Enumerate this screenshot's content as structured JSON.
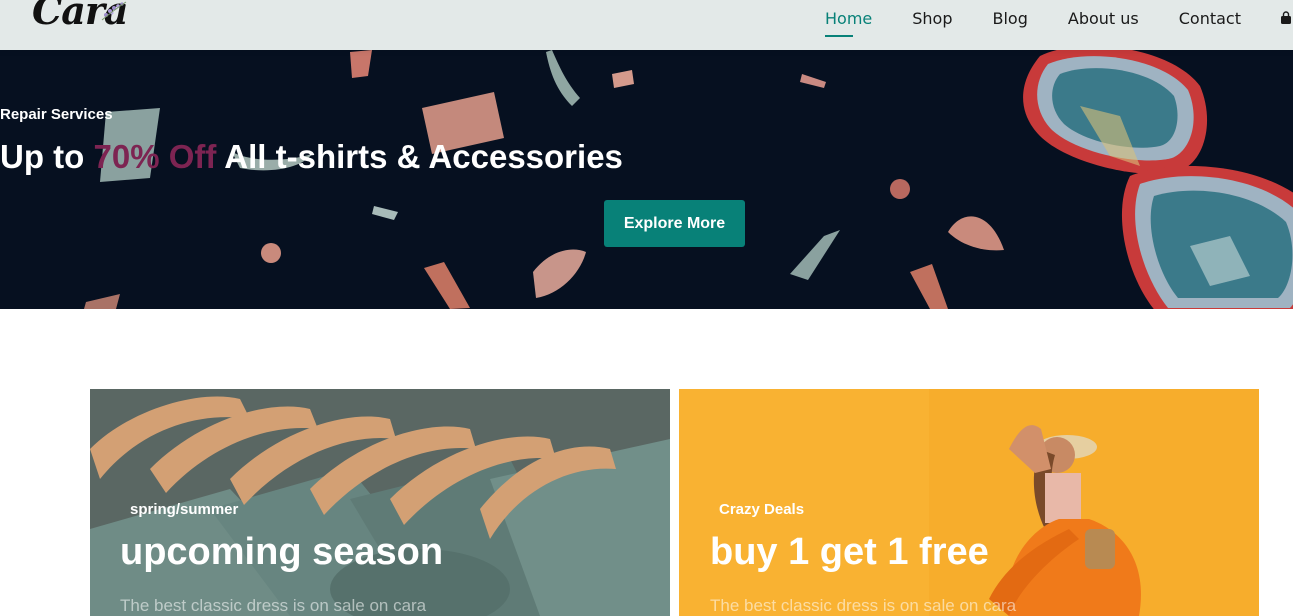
{
  "header": {
    "logo_text": "Cara",
    "nav": [
      {
        "label": "Home",
        "active": true
      },
      {
        "label": "Shop",
        "active": false
      },
      {
        "label": "Blog",
        "active": false
      },
      {
        "label": "About us",
        "active": false
      },
      {
        "label": "Contact",
        "active": false
      }
    ],
    "cart_icon": "shopping-bag-icon"
  },
  "hero": {
    "kicker": "Repair Services",
    "title_prefix": "Up to ",
    "title_accent": "70% Off",
    "title_suffix": " All t-shirts & Accessories",
    "cta_label": "Explore More",
    "accent_color": "#7d2452",
    "cta_color": "#088178"
  },
  "banners": [
    {
      "kicker": "spring/summer",
      "title": "upcoming season",
      "text": "The best classic dress is on sale on cara"
    },
    {
      "kicker": "Crazy Deals",
      "title": "buy 1 get 1 free",
      "text": "The best classic dress is on sale on cara"
    }
  ]
}
